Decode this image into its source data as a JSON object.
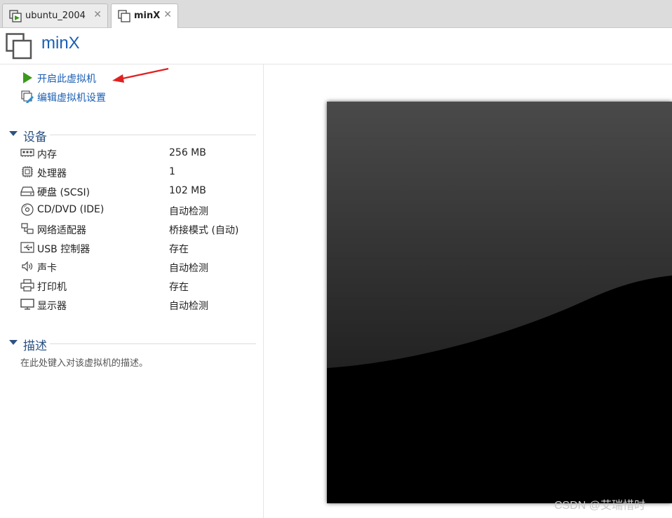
{
  "tabs": [
    {
      "label": "ubuntu_2004",
      "active": false,
      "icon": "vm-running-icon"
    },
    {
      "label": "minX",
      "active": true,
      "icon": "vm-icon"
    }
  ],
  "header": {
    "title": "minX"
  },
  "actions": {
    "power_on": "开启此虚拟机",
    "edit_settings": "编辑虚拟机设置"
  },
  "devices": {
    "section_label": "设备",
    "items": [
      {
        "name": "内存",
        "value": "256 MB",
        "icon": "memory-icon"
      },
      {
        "name": "处理器",
        "value": "1",
        "icon": "cpu-icon"
      },
      {
        "name": "硬盘 (SCSI)",
        "value": "102 MB",
        "icon": "hard-disk-icon"
      },
      {
        "name": "CD/DVD (IDE)",
        "value": "自动检测",
        "icon": "cd-dvd-icon"
      },
      {
        "name": "网络适配器",
        "value": "桥接模式 (自动)",
        "icon": "network-icon"
      },
      {
        "name": "USB 控制器",
        "value": "存在",
        "icon": "usb-icon"
      },
      {
        "name": "声卡",
        "value": "自动检测",
        "icon": "sound-icon"
      },
      {
        "name": "打印机",
        "value": "存在",
        "icon": "printer-icon"
      },
      {
        "name": "显示器",
        "value": "自动检测",
        "icon": "monitor-icon"
      }
    ]
  },
  "description": {
    "section_label": "描述",
    "placeholder": "在此处键入对该虚拟机的描述。"
  },
  "watermark": "CSDN @艾瑞惜时",
  "colors": {
    "link": "#1a5fb4",
    "section": "#2c5283",
    "play": "#3a9a1a",
    "annotation_arrow": "#e02020"
  }
}
